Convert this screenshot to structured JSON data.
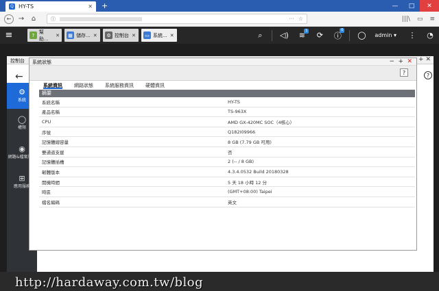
{
  "browser": {
    "tab_title": "HY-TS",
    "tab_icon_glyph": "Q",
    "new_tab": "+",
    "minimize": "—",
    "maximize": "□",
    "close": "✕"
  },
  "nav": {
    "back": "←",
    "forward": "→",
    "home": "⌂",
    "info": "ⓘ",
    "url_actions": [
      "···",
      "☆"
    ],
    "right_icons": [
      "|||\\",
      "▭",
      "≡"
    ]
  },
  "qts": {
    "menu_icon": "≡",
    "app_tabs": [
      {
        "label": "幫助...",
        "color": "#6ea83d",
        "glyph": "?"
      },
      {
        "label": "儲存...",
        "color": "#3a7bd5",
        "glyph": "▦"
      },
      {
        "label": "控制台",
        "color": "#666666",
        "glyph": "⚙"
      },
      {
        "label": "系統...",
        "color": "#3a7bd5",
        "glyph": "▭"
      }
    ],
    "tab_close": "✕",
    "right_icons": {
      "search": "⌕",
      "volume": "◁)",
      "tasks": "≋",
      "tasks_badge": "1",
      "sync": "⟳",
      "notifications": "ⓘ",
      "notifications_badge": "6",
      "user": "◯",
      "menu": "⋮",
      "dashboard": "◔"
    },
    "username": "admin ▾"
  },
  "control_panel": {
    "title": "控制台",
    "back": "←",
    "help": "?",
    "window_controls": "− + ✕",
    "sidebar": [
      {
        "label": "系統",
        "icon": "⚙"
      },
      {
        "label": "權限",
        "icon": "◯"
      },
      {
        "label": "網路&檔案服務",
        "icon": "◉"
      },
      {
        "label": "應用服務",
        "icon": "⊞"
      }
    ]
  },
  "dialog": {
    "title": "系統狀態",
    "minimize": "−",
    "maximize": "+",
    "close": "✕",
    "help": "?",
    "tabs": [
      "系統資訊",
      "網路狀態",
      "系統服務資訊",
      "硬體資訊"
    ],
    "section": "摘要",
    "rows": [
      {
        "label": "系統名稱",
        "value": "HY-TS"
      },
      {
        "label": "產品名稱",
        "value": "TS-963X"
      },
      {
        "label": "CPU",
        "value": "AMD GX-420MC SOC（4核心）"
      },
      {
        "label": "序號",
        "value": "Q182I09966"
      },
      {
        "label": "記憶體總容量",
        "value": "8 GB (7.79 GB 可用)"
      },
      {
        "label": "雙通道支援",
        "value": "否"
      },
      {
        "label": "記憶體插槽",
        "value": "2 (-- / 8 GB)"
      },
      {
        "label": "韌體版本",
        "value": "4.3.4.0532 Build 20180328"
      },
      {
        "label": "開機時間",
        "value": "5 天 18 小時 12 分"
      },
      {
        "label": "時區",
        "value": "(GMT+08:00) Taipei"
      },
      {
        "label": "檔名編碼",
        "value": "英文"
      }
    ]
  },
  "watermark": "http://hardaway.com.tw/blog"
}
